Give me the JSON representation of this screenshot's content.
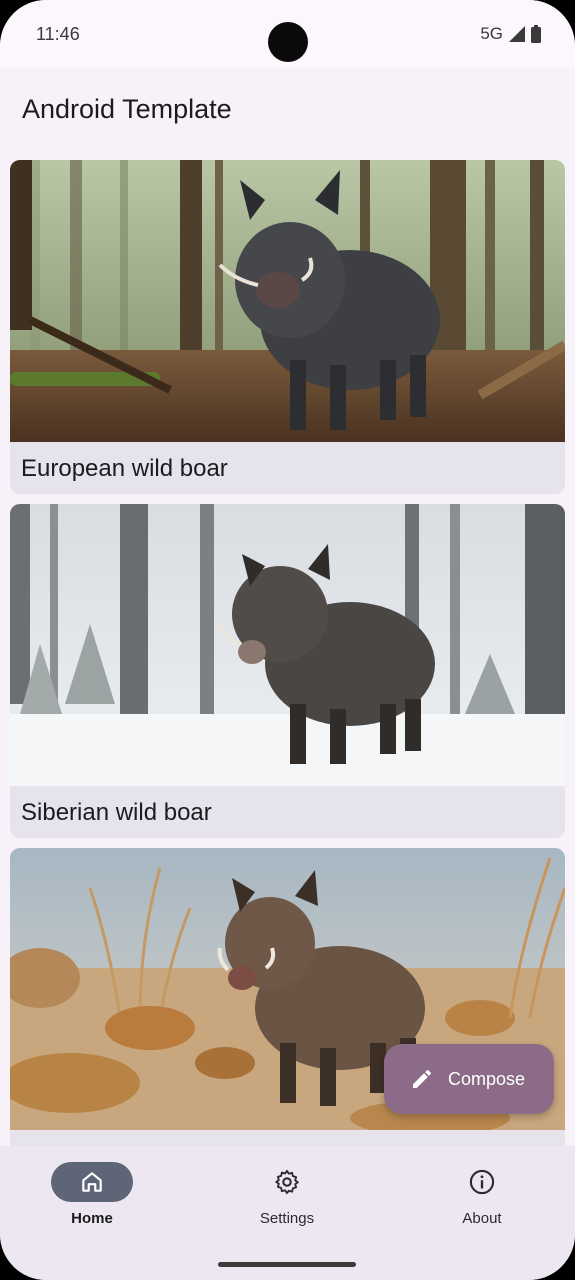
{
  "status_bar": {
    "time": "11:46",
    "network": "5G"
  },
  "app_bar": {
    "title": "Android Template"
  },
  "list": {
    "items": [
      {
        "label": "European wild boar",
        "image": "boar-forest-image"
      },
      {
        "label": "Siberian wild boar",
        "image": "boar-snow-image"
      },
      {
        "label": "",
        "image": "boar-steppe-image"
      }
    ]
  },
  "fab": {
    "label": "Compose",
    "icon": "pencil-icon"
  },
  "nav": {
    "items": [
      {
        "label": "Home",
        "icon": "home-icon",
        "selected": true
      },
      {
        "label": "Settings",
        "icon": "gear-icon",
        "selected": false
      },
      {
        "label": "About",
        "icon": "info-icon",
        "selected": false
      }
    ]
  },
  "colors": {
    "surface": "#f7f2fa",
    "card": "#e6e3ec",
    "fab": "#8b6b88",
    "nav_indicator": "#5e6577"
  }
}
